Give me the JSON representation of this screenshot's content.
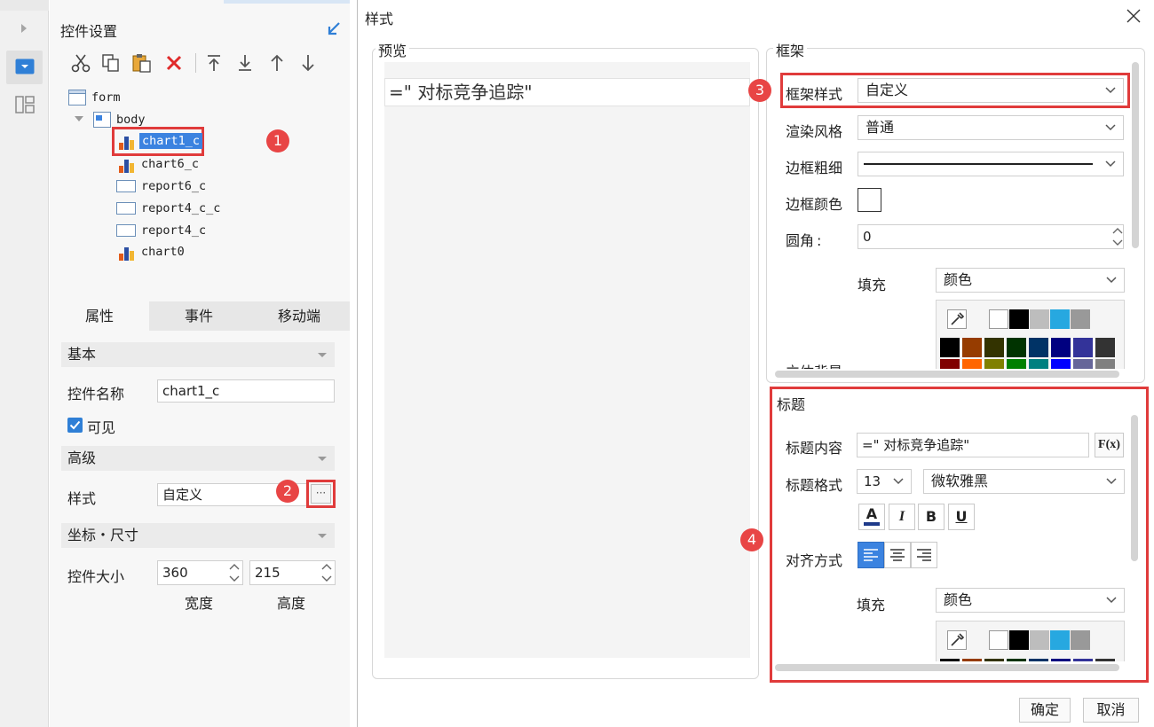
{
  "left_panel": {
    "title": "控件设置",
    "toolbar_icons": [
      "cut-icon",
      "copy-icon",
      "paste-icon",
      "delete-icon",
      "move-top-icon",
      "move-bottom-icon",
      "move-up-icon",
      "move-down-icon"
    ],
    "tree": [
      {
        "label": "form",
        "type": "form"
      },
      {
        "label": "body",
        "type": "body"
      },
      {
        "label": "chart1_c",
        "type": "chart",
        "selected": true
      },
      {
        "label": "chart6_c",
        "type": "chart"
      },
      {
        "label": "report6_c",
        "type": "report"
      },
      {
        "label": "report4_c_c",
        "type": "report"
      },
      {
        "label": "report4_c",
        "type": "report"
      },
      {
        "label": "chart0",
        "type": "chart"
      }
    ],
    "tabs": [
      "属性",
      "事件",
      "移动端"
    ],
    "basic": {
      "label": "基本",
      "name_label": "控件名称",
      "name_value": "chart1_c",
      "visible_label": "可见",
      "visible": true
    },
    "advanced": {
      "label": "高级",
      "style_label": "样式",
      "style_value": "自定义",
      "more": "···"
    },
    "coords": {
      "label": "坐标・尺寸",
      "size_label": "控件大小",
      "width": "360",
      "height": "215",
      "width_label": "宽度",
      "height_label": "高度"
    }
  },
  "dialog": {
    "title": "样式",
    "preview": {
      "label": "预览",
      "text": "=\"  对标竞争追踪\""
    },
    "frame": {
      "label": "框架",
      "style_label": "框架样式",
      "style_value": "自定义",
      "render_label": "渲染风格",
      "render_value": "普通",
      "border_width_label": "边框粗细",
      "border_color_label": "边框颜色",
      "radius_label": "圆角",
      "radius_colon": ":",
      "radius_value": "0",
      "fill_label": "填充",
      "fill_value": "颜色",
      "cutoff_label": "立体背景"
    },
    "title_section": {
      "label": "标题",
      "content_label": "标题内容",
      "content_value": "=\" 对标竞争追踪\"",
      "formula_button": "F(x)",
      "format_label": "标题格式",
      "font_size": "13",
      "font_name": "微软雅黑",
      "format_buttons": {
        "color": "A",
        "italic": "I",
        "bold": "B",
        "underline": "U"
      },
      "align_label": "对齐方式",
      "fill_label": "填充",
      "fill_value": "颜色"
    },
    "ok": "确定",
    "cancel": "取消"
  },
  "badges": [
    "1",
    "2",
    "3",
    "4"
  ],
  "colors": {
    "accent_red": "#e03b3b",
    "badge_red": "#e84545",
    "selection_blue": "#3b83e0",
    "palette_top": [
      "#ffffff",
      "#000000",
      "#bdbdbd",
      "#27a8e0",
      "#999999"
    ],
    "palette_row1": [
      "#000000",
      "#963c00",
      "#333300",
      "#003300",
      "#003366",
      "#000080",
      "#333399",
      "#333333"
    ],
    "palette_row2": [
      "#800000",
      "#ff6600",
      "#808000",
      "#008000",
      "#008080",
      "#0000ff",
      "#666699",
      "#808080"
    ]
  }
}
